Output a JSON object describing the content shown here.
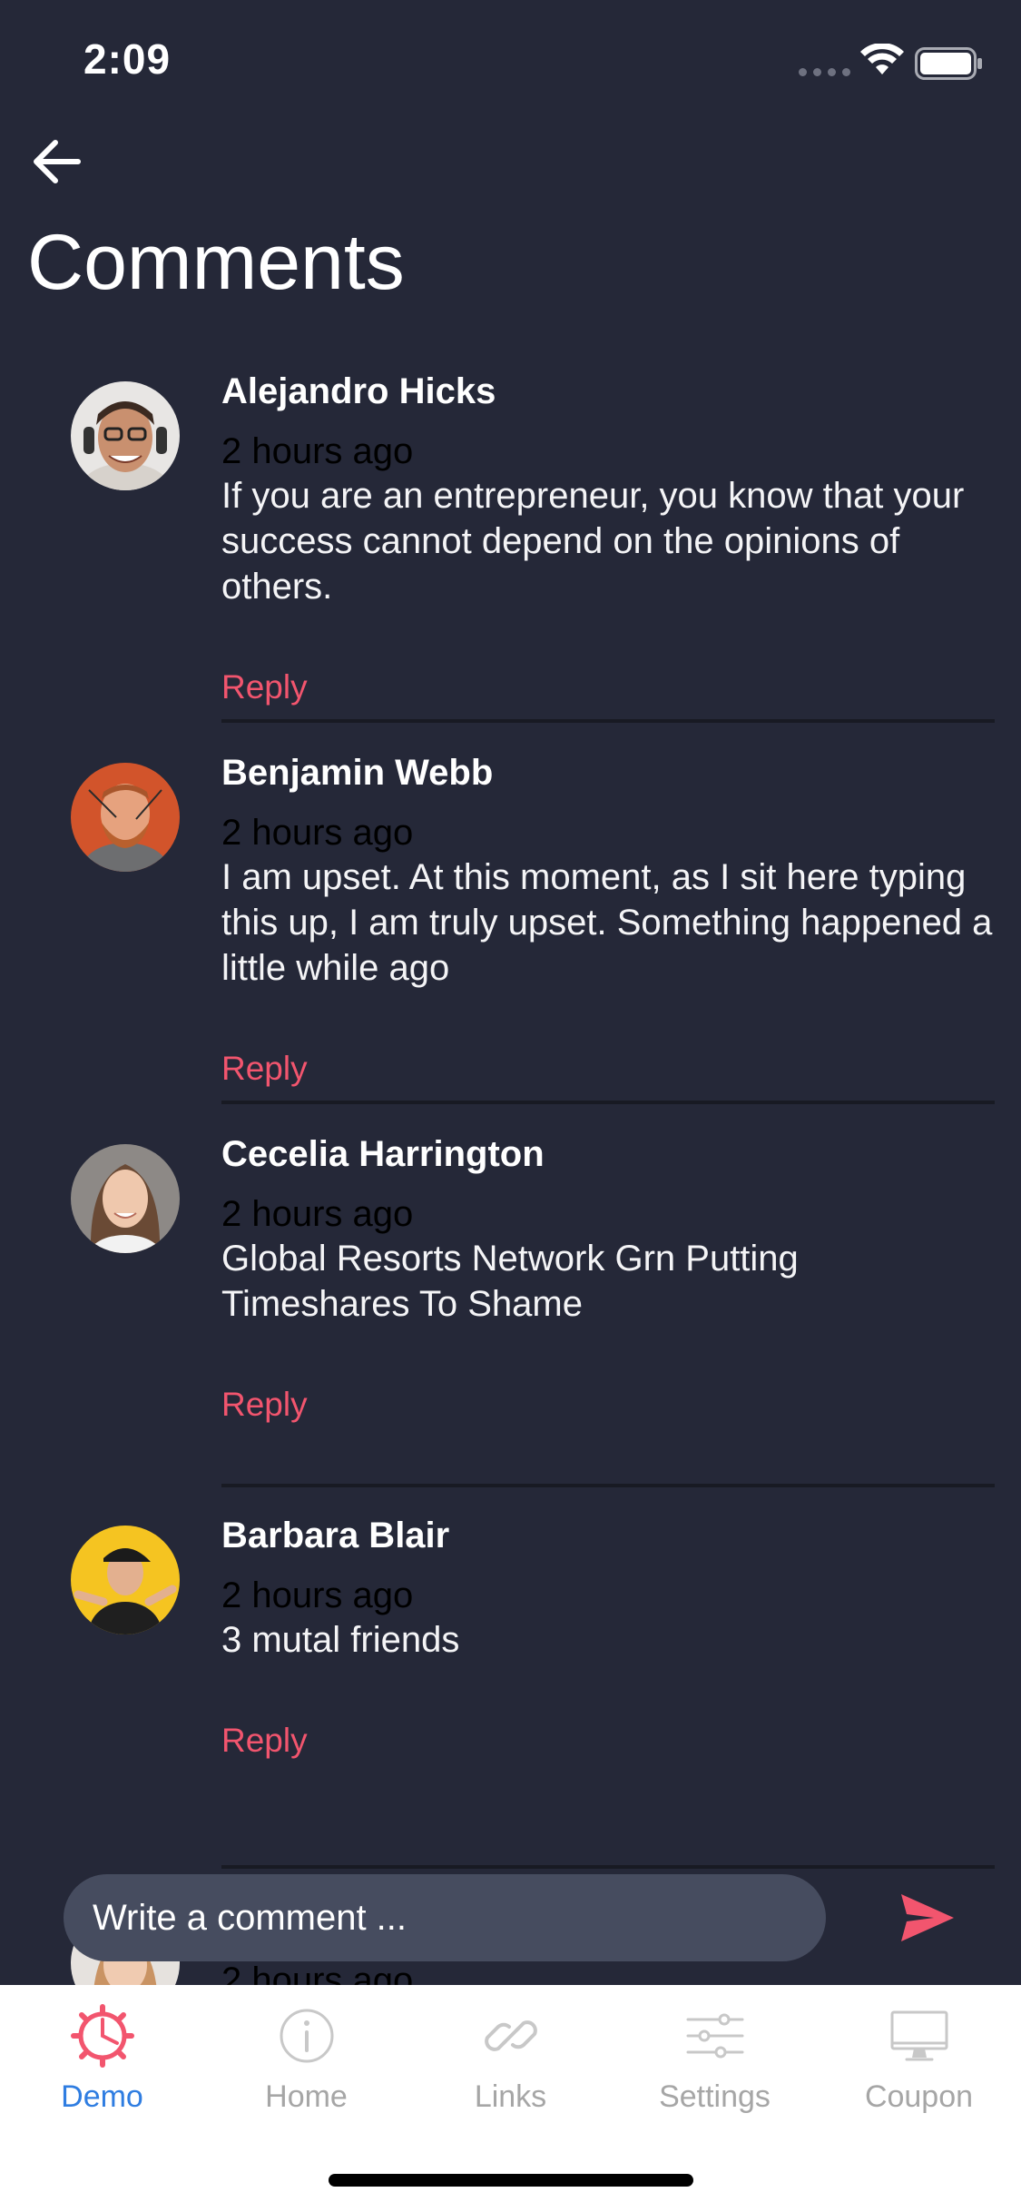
{
  "status": {
    "time": "2:09"
  },
  "header": {
    "title": "Comments"
  },
  "comments": [
    {
      "author": "Alejandro Hicks",
      "time": "2 hours ago",
      "text": "If you are an entrepreneur, you know that your success cannot depend on the opinions of others.",
      "reply": "Reply"
    },
    {
      "author": "Benjamin Webb",
      "time": "2 hours ago",
      "text": "I am upset. At this moment, as I sit here typing this up, I am truly upset. Something happened a little while ago",
      "reply": "Reply"
    },
    {
      "author": "Cecelia Harrington",
      "time": "2 hours ago",
      "text": "Global Resorts Network Grn Putting Timeshares To Shame",
      "reply": "Reply"
    },
    {
      "author": "Barbara Blair",
      "time": "2 hours ago",
      "text": "3 mutal friends",
      "reply": "Reply"
    },
    {
      "time": "2 hours ago"
    }
  ],
  "composer": {
    "placeholder": "Write a comment ..."
  },
  "tabs": [
    {
      "label": "Demo",
      "icon": "demo-gear-icon",
      "active": true
    },
    {
      "label": "Home",
      "icon": "info-icon",
      "active": false
    },
    {
      "label": "Links",
      "icon": "link-icon",
      "active": false
    },
    {
      "label": "Settings",
      "icon": "sliders-icon",
      "active": false
    },
    {
      "label": "Coupon",
      "icon": "monitor-icon",
      "active": false
    }
  ],
  "colors": {
    "background": "#252838",
    "accent": "#f2556e",
    "send": "#f2556e",
    "tab_active": "#2f7de1",
    "tab_inactive": "#a6a6a6",
    "composer": "#464c5f"
  }
}
